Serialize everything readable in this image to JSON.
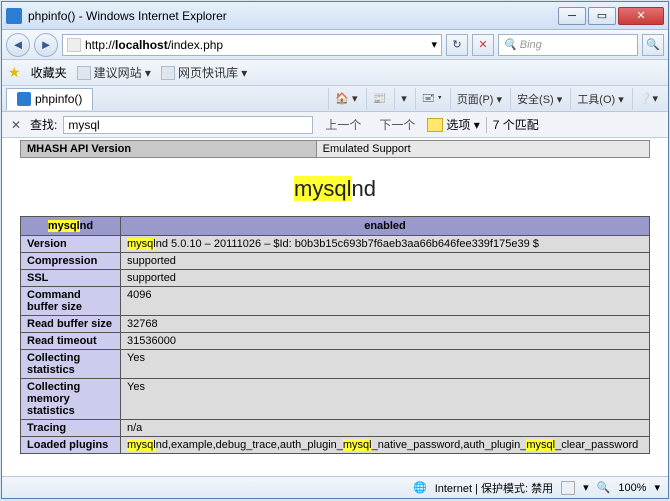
{
  "title": "phpinfo() - Windows Internet Explorer",
  "url_prefix": "http://",
  "url_host": "localhost",
  "url_path": "/index.php",
  "search_ph": "Bing",
  "fav_label": "收藏夹",
  "fav_items": [
    "建议网站 ▾",
    "网页快讯库 ▾"
  ],
  "tab_label": "phpinfo()",
  "toolbar": [
    "🏠 ▾",
    "📰",
    "▾",
    "🖃 ▾",
    "页面(P) ▾",
    "安全(S) ▾",
    "工具(O) ▾",
    "❔▾"
  ],
  "find": {
    "label": "查找:",
    "value": "mysql",
    "prev": "上一个",
    "next": "下一个",
    "options": "选项 ▾",
    "matches": "7 个匹配"
  },
  "mhash_key": "MHASH API Version",
  "mhash_val": "Emulated Support",
  "section_hl": "mysql",
  "section_rest": "nd",
  "header_hl": "mysql",
  "header_rest": "nd",
  "header_right": "enabled",
  "rows": [
    {
      "k": "Version",
      "pre": "",
      "hl": "mysql",
      "post": "nd 5.0.10 – 20111026 – $Id: b0b3b15c693b7f6aeb3aa66b646fee339f175e39 $"
    },
    {
      "k": "Compression",
      "pre": "supported",
      "hl": "",
      "post": ""
    },
    {
      "k": "SSL",
      "pre": "supported",
      "hl": "",
      "post": ""
    },
    {
      "k": "Command buffer size",
      "pre": "4096",
      "hl": "",
      "post": ""
    },
    {
      "k": "Read buffer size",
      "pre": "32768",
      "hl": "",
      "post": ""
    },
    {
      "k": "Read timeout",
      "pre": "31536000",
      "hl": "",
      "post": ""
    },
    {
      "k": "Collecting statistics",
      "pre": "Yes",
      "hl": "",
      "post": ""
    },
    {
      "k": "Collecting memory statistics",
      "pre": "Yes",
      "hl": "",
      "post": ""
    },
    {
      "k": "Tracing",
      "pre": "n/a",
      "hl": "",
      "post": ""
    }
  ],
  "loaded_key": "Loaded plugins",
  "loaded_parts": [
    "mysql",
    "nd,example,debug_trace,auth_plugin_",
    "mysql",
    "_native_password,auth_plugin_",
    "mysql",
    "_clear_password"
  ],
  "status": {
    "zone": "Internet | 保护模式: 禁用",
    "zoom": "100%"
  }
}
